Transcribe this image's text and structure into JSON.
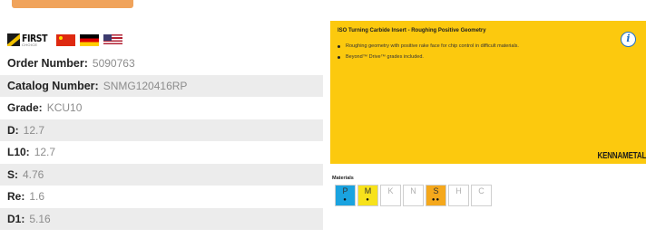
{
  "brand": {
    "logo_word": "FIRST",
    "logo_sub": "CHOICE",
    "flags": [
      "china-flag",
      "germany-flag",
      "usa-flag"
    ]
  },
  "specs": [
    {
      "label": "Order Number:",
      "value": "5090763"
    },
    {
      "label": "Catalog Number:",
      "value": "SNMG120416RP"
    },
    {
      "label": "Grade:",
      "value": "KCU10"
    },
    {
      "label": "D:",
      "value": "12.7"
    },
    {
      "label": "L10:",
      "value": "12.7"
    },
    {
      "label": "S:",
      "value": "4.76"
    },
    {
      "label": "Re:",
      "value": "1.6"
    },
    {
      "label": "D1:",
      "value": "5.16"
    }
  ],
  "product": {
    "title": "ISO Turning Carbide Insert - Roughing Positive Geometry",
    "bullets": [
      "Roughing geometry with positive rake face for chip control in difficult materials.",
      "Beyond™ Drive™ grades included."
    ],
    "wordmark": "KENNAMETAL",
    "info_icon_glyph": "i"
  },
  "materials": {
    "title": "Materials",
    "cells": [
      {
        "letter": "P",
        "color": "#1aa3e0",
        "dots": "●"
      },
      {
        "letter": "M",
        "color": "#f7e21b",
        "dots": "●"
      },
      {
        "letter": "K",
        "color": "#ffffff",
        "dots": ""
      },
      {
        "letter": "N",
        "color": "#ffffff",
        "dots": ""
      },
      {
        "letter": "S",
        "color": "#f5a81c",
        "dots": "●●"
      },
      {
        "letter": "H",
        "color": "#ffffff",
        "dots": ""
      },
      {
        "letter": "C",
        "color": "#ffffff",
        "dots": ""
      }
    ]
  },
  "colors": {
    "card_yellow": "#fcc90e",
    "top_button": "#f0a35b",
    "row_shade": "#ececec"
  }
}
